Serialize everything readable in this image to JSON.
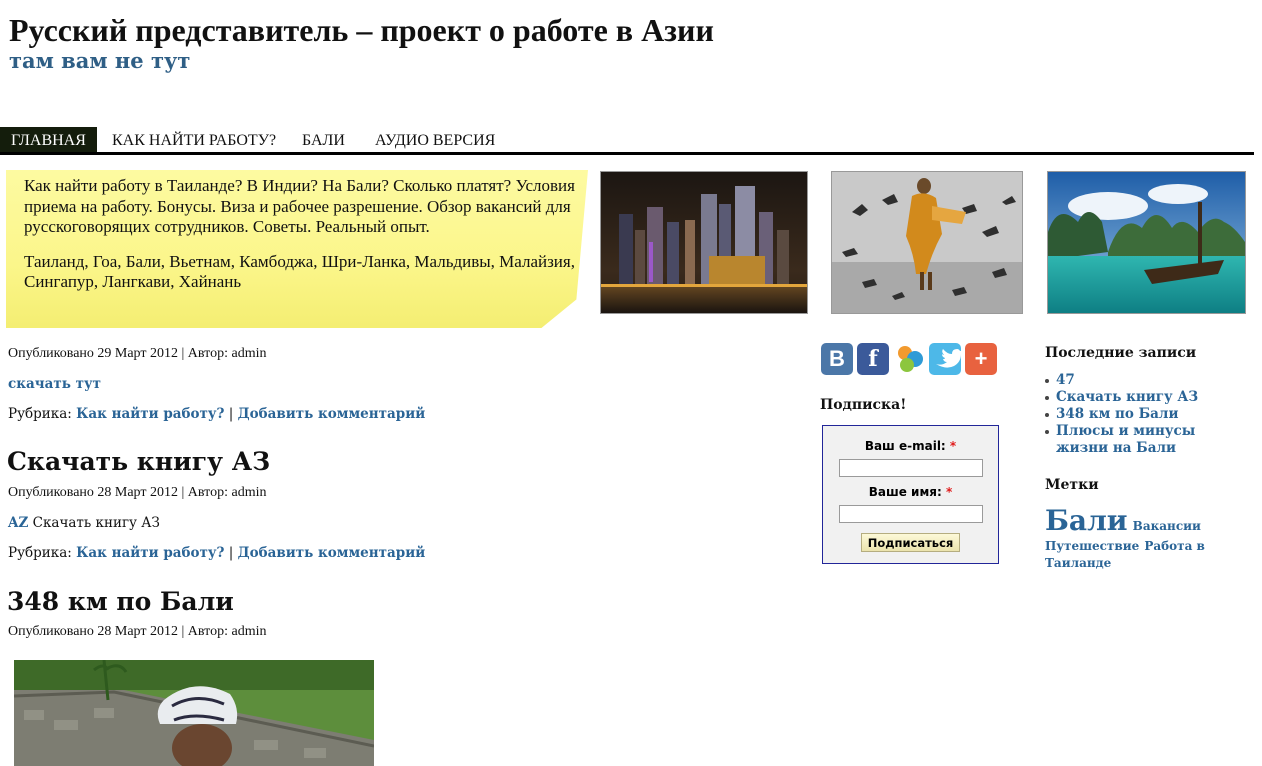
{
  "site": {
    "title": "Русский представитель – проект о работе в Азии",
    "tagline": "там вам не тут"
  },
  "nav": [
    {
      "label": "ГЛАВНАЯ",
      "active": true
    },
    {
      "label": "КАК НАЙТИ РАБОТУ?",
      "active": false
    },
    {
      "label": "БАЛИ",
      "active": false
    },
    {
      "label": "АУДИО ВЕРСИЯ",
      "active": false
    }
  ],
  "intro": {
    "line1": "Как найти работу в Таиланде? В Индии? На Бали? Сколько платят? Условия приема на работу. Бонусы. Виза и рабочее разрешение. Обзор вакансий для русскоговорящих сотрудников. Советы. Реальный опыт.",
    "line2": "Таиланд, Гоа, Бали, Вьетнам, Камбоджа, Шри-Ланка, Мальдивы, Малайзия, Сингапур, Лангкави, Хайнань"
  },
  "posts": [
    {
      "title": "",
      "meta": "Опубликовано 29 Март 2012 | Автор: admin",
      "body_link": "скачать тут",
      "body_text": "",
      "category_label": "Рубрика: ",
      "category": "Как найти работу?",
      "separator": " | ",
      "comment": "Добавить комментарий"
    },
    {
      "title": "Скачать книгу АЗ",
      "meta": "Опубликовано 28 Март 2012 | Автор: admin",
      "body_link": "AZ",
      "body_text": " Скачать книгу АЗ",
      "category_label": "Рубрика: ",
      "category": "Как найти работу?",
      "separator": " | ",
      "comment": "Добавить комментарий"
    },
    {
      "title": "348 км по Бали",
      "meta": "Опубликовано 28 Март 2012 | Автор: admin"
    }
  ],
  "social": [
    {
      "icon": "vkontakte-icon",
      "glyph": "В",
      "color": "#4b77a8"
    },
    {
      "icon": "facebook-icon",
      "glyph": "f",
      "color": "#3b5a9a"
    },
    {
      "icon": "moimir-icon",
      "glyph": "",
      "color": "#ffffff"
    },
    {
      "icon": "twitter-icon",
      "glyph": "",
      "color": "#4db8e8"
    },
    {
      "icon": "share-plus-icon",
      "glyph": "+",
      "color": "#e8623f"
    }
  ],
  "subscribe": {
    "heading": "Подписка!",
    "email_label": "Ваш e-mail: ",
    "name_label": "Ваше имя: ",
    "required": "*",
    "button": "Подписаться"
  },
  "recent": {
    "heading": "Последние записи",
    "items": [
      "47",
      "Скачать книгу АЗ",
      "348 км по Бали",
      "Плюсы и минусы жизни на Бали"
    ]
  },
  "tags": {
    "heading": "Метки",
    "items": [
      "Бали",
      "Вакансии",
      "Путешествие",
      "Работа в Таиланде"
    ]
  }
}
